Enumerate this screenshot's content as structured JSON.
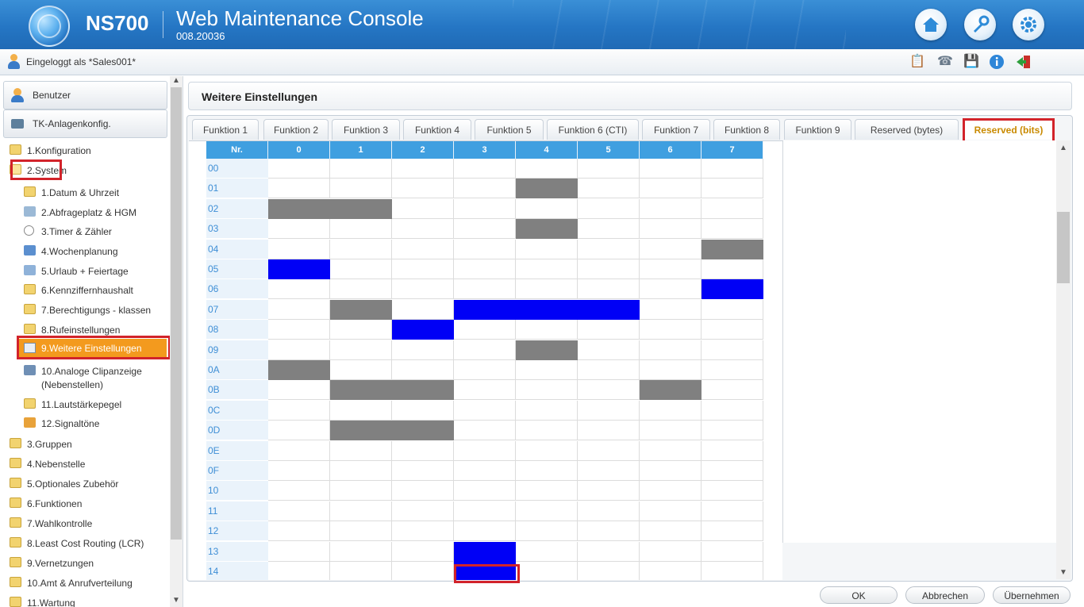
{
  "header": {
    "brand": "NS700",
    "title": "Web Maintenance Console",
    "version": "008.20036",
    "buttons": [
      "home-icon",
      "wrench-icon",
      "gear-icon"
    ]
  },
  "login": {
    "text": "Eingeloggt als *Sales001*",
    "tools": [
      "report-icon",
      "pbx-icon",
      "save-icon",
      "info-icon",
      "logout-icon"
    ]
  },
  "sidebar": {
    "sections": [
      {
        "label": "Benutzer",
        "icon": "user-icon"
      },
      {
        "label": "TK-Anlagenkonfig.",
        "icon": "pbx-config-icon"
      }
    ],
    "tree": [
      {
        "label": "1.Konfiguration"
      },
      {
        "label": "2.System"
      },
      {
        "label": "1.Datum & Uhrzeit"
      },
      {
        "label": "2.Abfrageplatz & HGM"
      },
      {
        "label": "3.Timer & Zähler"
      },
      {
        "label": "4.Wochenplanung"
      },
      {
        "label": "5.Urlaub + Feiertage"
      },
      {
        "label": "6.Kennziffernhaushalt"
      },
      {
        "label": "7.Berechtigungs - klassen"
      },
      {
        "label": "8.Rufeinstellungen"
      },
      {
        "label": "9.Weitere Einstellungen"
      },
      {
        "label": "10.Analoge Clipanzeige"
      },
      {
        "label": "(Nebenstellen)"
      },
      {
        "label": "11.Lautstärkepegel"
      },
      {
        "label": "12.Signaltöne"
      },
      {
        "label": "3.Gruppen"
      },
      {
        "label": "4.Nebenstelle"
      },
      {
        "label": "5.Optionales Zubehör"
      },
      {
        "label": "6.Funktionen"
      },
      {
        "label": "7.Wahlkontrolle"
      },
      {
        "label": "8.Least Cost Routing (LCR)"
      },
      {
        "label": "9.Vernetzungen"
      },
      {
        "label": "10.Amt & Anrufverteilung"
      },
      {
        "label": "11.Wartung"
      }
    ]
  },
  "main": {
    "page_title": "Weitere Einstellungen",
    "tabs": [
      "Funktion 1",
      "Funktion 2",
      "Funktion 3",
      "Funktion 4",
      "Funktion 5",
      "Funktion 6 (CTI)",
      "Funktion 7",
      "Funktion 8",
      "Funktion 9",
      "Reserved (bytes)",
      "Reserved (bits)"
    ],
    "active_tab": "Reserved (bits)",
    "grid": {
      "col_header": "Nr.",
      "columns": [
        "0",
        "1",
        "2",
        "3",
        "4",
        "5",
        "6",
        "7"
      ],
      "rows": [
        {
          "label": "00",
          "cells": [
            "w",
            "w",
            "w",
            "w",
            "w",
            "w",
            "w",
            "w"
          ]
        },
        {
          "label": "01",
          "cells": [
            "w",
            "w",
            "w",
            "w",
            "g",
            "w",
            "w",
            "w"
          ]
        },
        {
          "label": "02",
          "cells": [
            "g",
            "g",
            "w",
            "w",
            "w",
            "w",
            "w",
            "w"
          ]
        },
        {
          "label": "03",
          "cells": [
            "w",
            "w",
            "w",
            "w",
            "g",
            "w",
            "w",
            "w"
          ]
        },
        {
          "label": "04",
          "cells": [
            "w",
            "w",
            "w",
            "w",
            "w",
            "w",
            "w",
            "g"
          ]
        },
        {
          "label": "05",
          "cells": [
            "b",
            "w",
            "w",
            "w",
            "w",
            "w",
            "w",
            "w"
          ]
        },
        {
          "label": "06",
          "cells": [
            "w",
            "w",
            "w",
            "w",
            "w",
            "w",
            "w",
            "b"
          ]
        },
        {
          "label": "07",
          "cells": [
            "w",
            "g",
            "w",
            "b",
            "b",
            "b",
            "w",
            "w"
          ]
        },
        {
          "label": "08",
          "cells": [
            "w",
            "w",
            "b",
            "w",
            "w",
            "w",
            "w",
            "w"
          ]
        },
        {
          "label": "09",
          "cells": [
            "w",
            "w",
            "w",
            "w",
            "g",
            "w",
            "w",
            "w"
          ]
        },
        {
          "label": "0A",
          "cells": [
            "g",
            "w",
            "w",
            "w",
            "w",
            "w",
            "w",
            "w"
          ]
        },
        {
          "label": "0B",
          "cells": [
            "w",
            "g",
            "g",
            "w",
            "w",
            "w",
            "g",
            "w"
          ]
        },
        {
          "label": "0C",
          "cells": [
            "w",
            "w",
            "w",
            "w",
            "w",
            "w",
            "w",
            "w"
          ]
        },
        {
          "label": "0D",
          "cells": [
            "w",
            "g",
            "g",
            "w",
            "w",
            "w",
            "w",
            "w"
          ]
        },
        {
          "label": "0E",
          "cells": [
            "w",
            "w",
            "w",
            "w",
            "w",
            "w",
            "w",
            "w"
          ]
        },
        {
          "label": "0F",
          "cells": [
            "w",
            "w",
            "w",
            "w",
            "w",
            "w",
            "w",
            "w"
          ]
        },
        {
          "label": "10",
          "cells": [
            "w",
            "w",
            "w",
            "w",
            "w",
            "w",
            "w",
            "w"
          ]
        },
        {
          "label": "11",
          "cells": [
            "w",
            "w",
            "w",
            "w",
            "w",
            "w",
            "w",
            "w"
          ]
        },
        {
          "label": "12",
          "cells": [
            "w",
            "w",
            "w",
            "w",
            "w",
            "w",
            "w",
            "w"
          ]
        },
        {
          "label": "13",
          "cells": [
            "w",
            "w",
            "w",
            "b",
            "w",
            "w",
            "w",
            "w"
          ]
        },
        {
          "label": "14",
          "cells": [
            "w",
            "w",
            "w",
            "b",
            "w",
            "w",
            "w",
            "w"
          ]
        }
      ],
      "colors": {
        "w": "#ffffff",
        "g": "#808080",
        "b": "#0000f6"
      }
    }
  },
  "footer": {
    "ok": "OK",
    "cancel": "Abbrechen",
    "apply": "Übernehmen"
  }
}
